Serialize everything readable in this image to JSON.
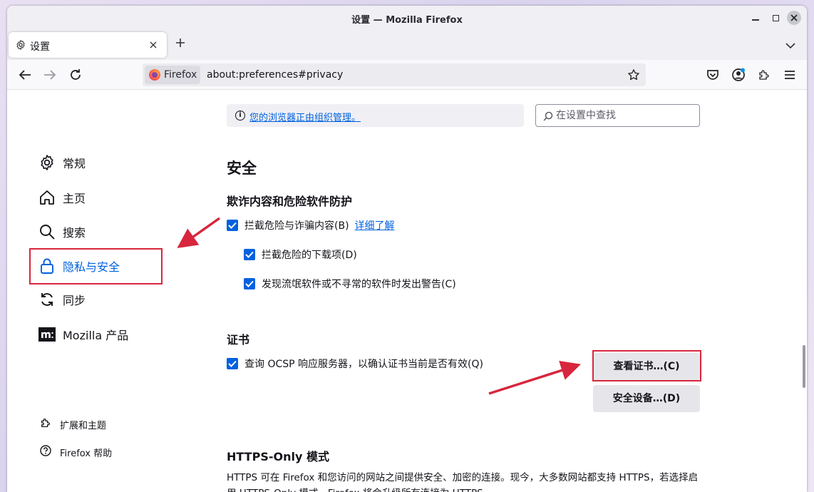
{
  "window": {
    "title": "设置 — Mozilla Firefox"
  },
  "tabs": [
    {
      "label": "设置",
      "icon": "gear-icon"
    }
  ],
  "nav": {
    "identity_label": "Firefox",
    "url": "about:preferences#privacy"
  },
  "managed_notice": "您的浏览器正由组织管理。",
  "search": {
    "placeholder": "在设置中查找"
  },
  "sidebar": {
    "items": [
      {
        "label": "常规",
        "icon": "gear-icon"
      },
      {
        "label": "主页",
        "icon": "home-icon"
      },
      {
        "label": "搜索",
        "icon": "search-icon"
      },
      {
        "label": "隐私与安全",
        "icon": "lock-icon",
        "active": true
      },
      {
        "label": "同步",
        "icon": "sync-icon"
      },
      {
        "label": "Mozilla 产品",
        "icon": "mozilla-logo-icon"
      }
    ],
    "footer": [
      {
        "label": "扩展和主题",
        "icon": "puzzle-icon"
      },
      {
        "label": "Firefox 帮助",
        "icon": "help-icon"
      }
    ]
  },
  "main": {
    "section_title": "安全",
    "phishing": {
      "heading": "欺诈内容和危险软件防护",
      "block_dangerous": "拦截危险与诈骗内容(B)",
      "learn_more": "详细了解",
      "block_downloads": "拦截危险的下载项(D)",
      "warn_unwanted": "发现流氓软件或不寻常的软件时发出警告(C)"
    },
    "certificates": {
      "heading": "证书",
      "ocsp": "查询 OCSP 响应服务器，以确认证书当前是否有效(Q)",
      "view_button": "查看证书…(C)",
      "devices_button": "安全设备…(D)"
    },
    "https_only": {
      "heading": "HTTPS-Only 模式",
      "description": "HTTPS 可在 Firefox 和您访问的网站之间提供安全、加密的连接。现今，大多数网站都支持 HTTPS，若选择启用 HTTPS-Only 模式，Firefox 将会升级所有连接为 HTTPS。"
    }
  },
  "colors": {
    "accent": "#0061e0",
    "annotation": "#d7263d"
  }
}
